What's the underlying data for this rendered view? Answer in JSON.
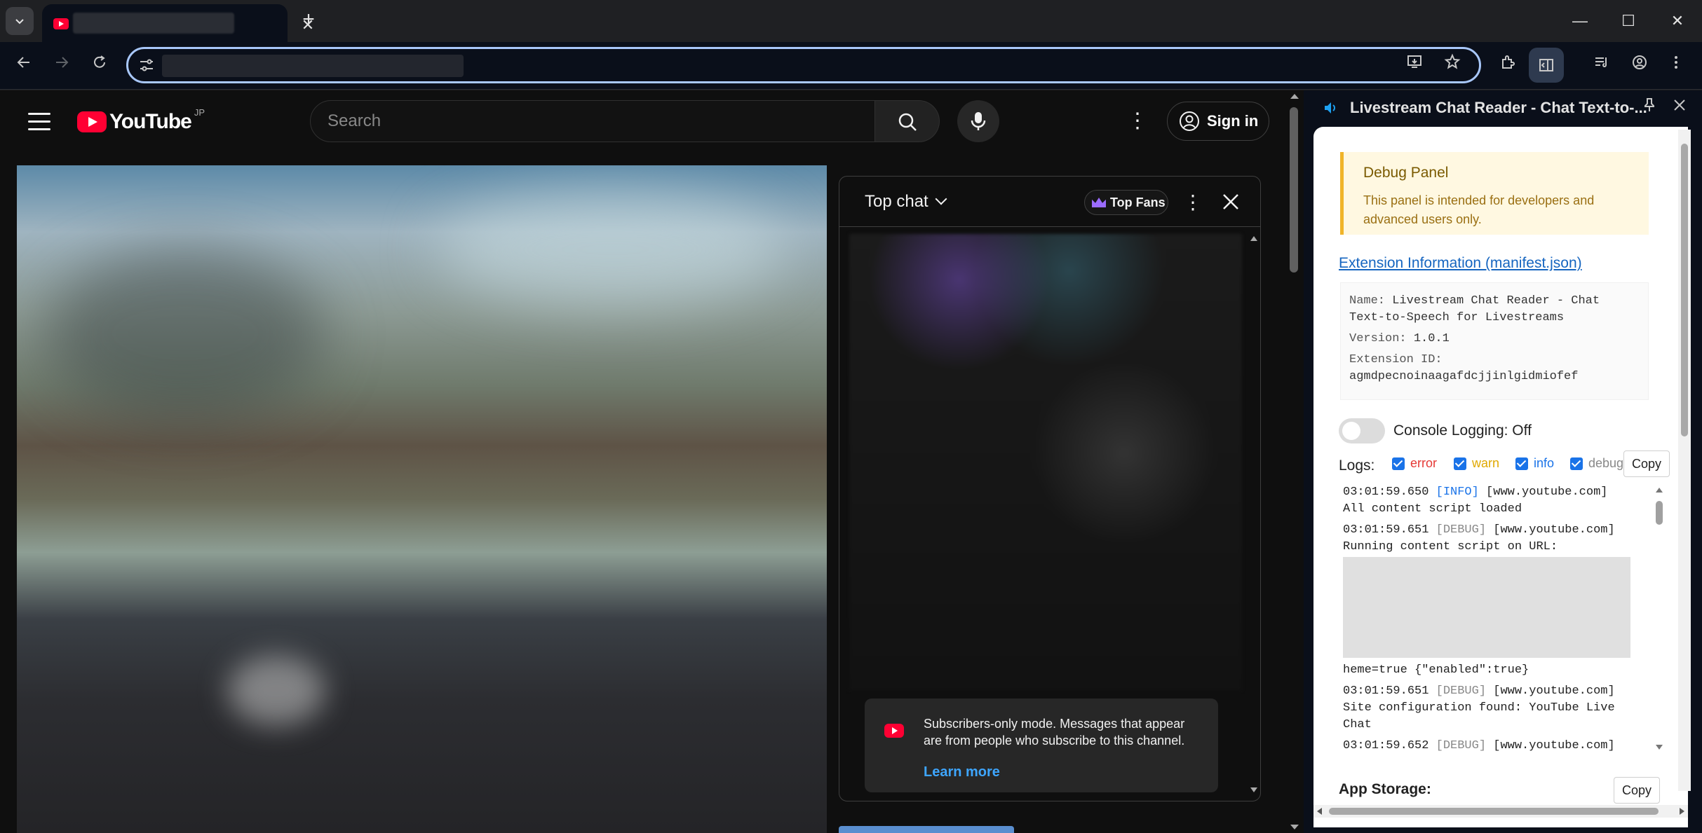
{
  "browser": {
    "tab_close_glyph": "✕",
    "new_tab_glyph": "+",
    "window_controls": [
      "—",
      "☐",
      "✕"
    ],
    "icons": [
      "tab-search-icon",
      "back-icon",
      "forward-icon",
      "reload-icon",
      "site-settings-icon",
      "install-app-icon",
      "bookmark-star-icon",
      "extensions-icon",
      "side-panel-icon",
      "reading-list-icon",
      "profile-icon",
      "chrome-menu-icon"
    ]
  },
  "youtube": {
    "logo_text": "YouTube",
    "region": "JP",
    "search_placeholder": "Search",
    "sign_in_label": "Sign in",
    "chat": {
      "title": "Top chat",
      "top_fans_label": "Top Fans",
      "notice_text": "Subscribers-only mode. Messages that appear are from people who subscribe to this channel.",
      "learn_more_label": "Learn more"
    },
    "colors": {
      "brand_red": "#ff0033",
      "link_blue": "#3ea6ff",
      "top_fans_crown": "#9b6cff"
    }
  },
  "sidepanel": {
    "title": "Livestream Chat Reader - Chat Text-to-...",
    "debug_title": "Debug Panel",
    "debug_desc": "This panel is intended for developers and advanced users only.",
    "ext_info_link": "Extension Information (manifest.json)",
    "manifest": {
      "name_key": "Name:",
      "name_val": "Livestream Chat Reader - Chat Text-to-Speech for Livestreams",
      "version_key": "Version:",
      "version_val": "1.0.1",
      "id_key": "Extension ID:",
      "id_val": "agmdpecnoinaagafdcjjinlgidmiofef"
    },
    "console_logging_label": "Console Logging: Off",
    "logs_label": "Logs:",
    "levels": [
      {
        "name": "error",
        "color": "#e53935"
      },
      {
        "name": "warn",
        "color": "#e0a800"
      },
      {
        "name": "info",
        "color": "#1a73e8"
      },
      {
        "name": "debug",
        "color": "#888888"
      }
    ],
    "copy_label": "Copy",
    "logs": [
      {
        "ts": "03:01:59.650",
        "level": "INFO",
        "host": "[www.youtube.com]",
        "msg": "All content script loaded"
      },
      {
        "ts": "03:01:59.651",
        "level": "DEBUG",
        "host": "[www.youtube.com]",
        "msg": "Running content script on URL:"
      },
      {
        "ts": "",
        "level": "",
        "host": "",
        "msg": "heme=true {\"enabled\":true}"
      },
      {
        "ts": "03:01:59.651",
        "level": "DEBUG",
        "host": "[www.youtube.com]",
        "msg": "Site configuration found: YouTube Live Chat"
      },
      {
        "ts": "03:01:59.652",
        "level": "DEBUG",
        "host": "[www.youtube.com]",
        "msg": ""
      }
    ],
    "app_storage_label": "App Storage:",
    "storage_copy_label": "Copy"
  }
}
